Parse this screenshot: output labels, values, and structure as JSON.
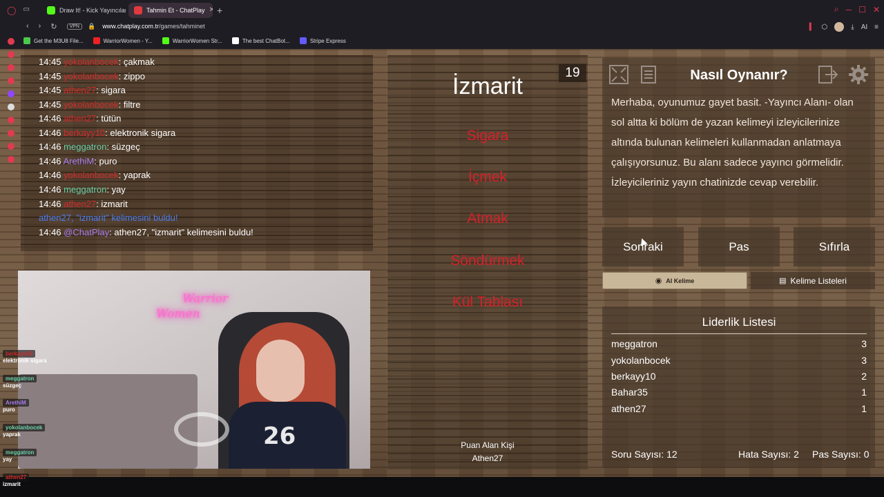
{
  "browser": {
    "tabs": [
      {
        "label": "Draw It! - Kick Yayıncıları",
        "color": "#53fc18",
        "active": false
      },
      {
        "label": "Tahmin Et - ChatPlay",
        "color": "#e03a3e",
        "active": true
      }
    ],
    "vpn_label": "VPN",
    "url_host": "www.chatplay.com.tr",
    "url_path": "/games/tahminet",
    "ai_label": "AI",
    "bookmarks": [
      {
        "label": "Get the M3U8 File...",
        "color": "#4ac94a"
      },
      {
        "label": "WarriorWomen - Y...",
        "color": "#e22"
      },
      {
        "label": "WarriorWomen Str...",
        "color": "#53fc18"
      },
      {
        "label": "The best ChatBot...",
        "color": "#ffffff"
      },
      {
        "label": "Stripe Express",
        "color": "#635bff"
      }
    ]
  },
  "chat": {
    "lines": [
      {
        "time": "14:45",
        "user": "yokolanbocek",
        "user_color": "#d22a2a",
        "msg": "çakmak"
      },
      {
        "time": "14:45",
        "user": "yokolanbocek",
        "user_color": "#d22a2a",
        "msg": "zippo"
      },
      {
        "time": "14:45",
        "user": "athen27",
        "user_color": "#d22a2a",
        "msg": "sigara"
      },
      {
        "time": "14:45",
        "user": "yokolanbocek",
        "user_color": "#d22a2a",
        "msg": "filtre"
      },
      {
        "time": "14:46",
        "user": "athen27",
        "user_color": "#d22a2a",
        "msg": "tütün"
      },
      {
        "time": "14:46",
        "user": "berkayy10",
        "user_color": "#d22a2a",
        "msg": "elektronik sigara"
      },
      {
        "time": "14:46",
        "user": "meggatron",
        "user_color": "#6ad0a8",
        "msg": "süzgeç"
      },
      {
        "time": "14:46",
        "user": "ArethiM",
        "user_color": "#a87cf0",
        "msg": "puro"
      },
      {
        "time": "14:46",
        "user": "yokolanbocek",
        "user_color": "#d22a2a",
        "msg": "yaprak"
      },
      {
        "time": "14:46",
        "user": "meggatron",
        "user_color": "#6ad0a8",
        "msg": "yay"
      },
      {
        "time": "14:46",
        "user": "athen27",
        "user_color": "#d22a2a",
        "msg": "izmarit"
      }
    ],
    "found_notice": "athen27, \"izmarit\" kelimesini buldu!",
    "bot_line": {
      "time": "14:46",
      "user": "@ChatPlay",
      "msg": "athen27, \"izmarit\" kelimesini buldu!"
    }
  },
  "overlay_chat": [
    {
      "user": "berkayy10",
      "user_color": "#d22a2a",
      "msg": "elektronik sigara"
    },
    {
      "user": "meggatron",
      "user_color": "#6ad0a8",
      "msg": "süzgeç"
    },
    {
      "user": "ArethiM",
      "user_color": "#a87cf0",
      "msg": "puro"
    },
    {
      "user": "yokolanbocek",
      "user_color": "#6ad0a8",
      "msg": "yaprak"
    },
    {
      "user": "meggatron",
      "user_color": "#6ad0a8",
      "msg": "yay"
    },
    {
      "user": "athen27",
      "user_color": "#d22a2a",
      "msg": "izmarit"
    }
  ],
  "webcam": {
    "neon_line1": "Warrior",
    "neon_line2": "Women",
    "shirt_text": "26"
  },
  "game": {
    "counter": "19",
    "word": "İzmarit",
    "forbidden": [
      "Sigara",
      "İçmek",
      "Atmak",
      "Söndürmek",
      "Kül Tablası"
    ],
    "scorer_label": "Puan Alan Kişi",
    "scorer_name": "Athen27"
  },
  "howto": {
    "title": "Nasıl Oynanır?",
    "text": "Merhaba, oyunumuz gayet basit. -Yayıncı Alanı- olan sol altta ki bölüm de yazan kelimeyi izleyicilerinize altında bulunan kelimeleri kullanmadan anlatmaya çalışıyorsunuz. Bu alanı sadece yayıncı görmelidir. İzleyicileriniz yayın chatinizde cevap verebilir."
  },
  "controls": {
    "next": "Sonraki",
    "pass": "Pas",
    "reset": "Sıfırla",
    "ai_word": "AI Kelime",
    "word_lists": "Kelime Listeleri"
  },
  "leaderboard": {
    "title": "Liderlik Listesi",
    "rows": [
      {
        "name": "meggatron",
        "score": "3"
      },
      {
        "name": "yokolanbocek",
        "score": "3"
      },
      {
        "name": "berkayy10",
        "score": "2"
      },
      {
        "name": "Bahar35",
        "score": "1"
      },
      {
        "name": "athen27",
        "score": "1"
      }
    ],
    "question_count": "Soru Sayısı: 12",
    "error_count": "Hata Sayısı: 2",
    "pass_count": "Pas Sayısı: 0"
  }
}
